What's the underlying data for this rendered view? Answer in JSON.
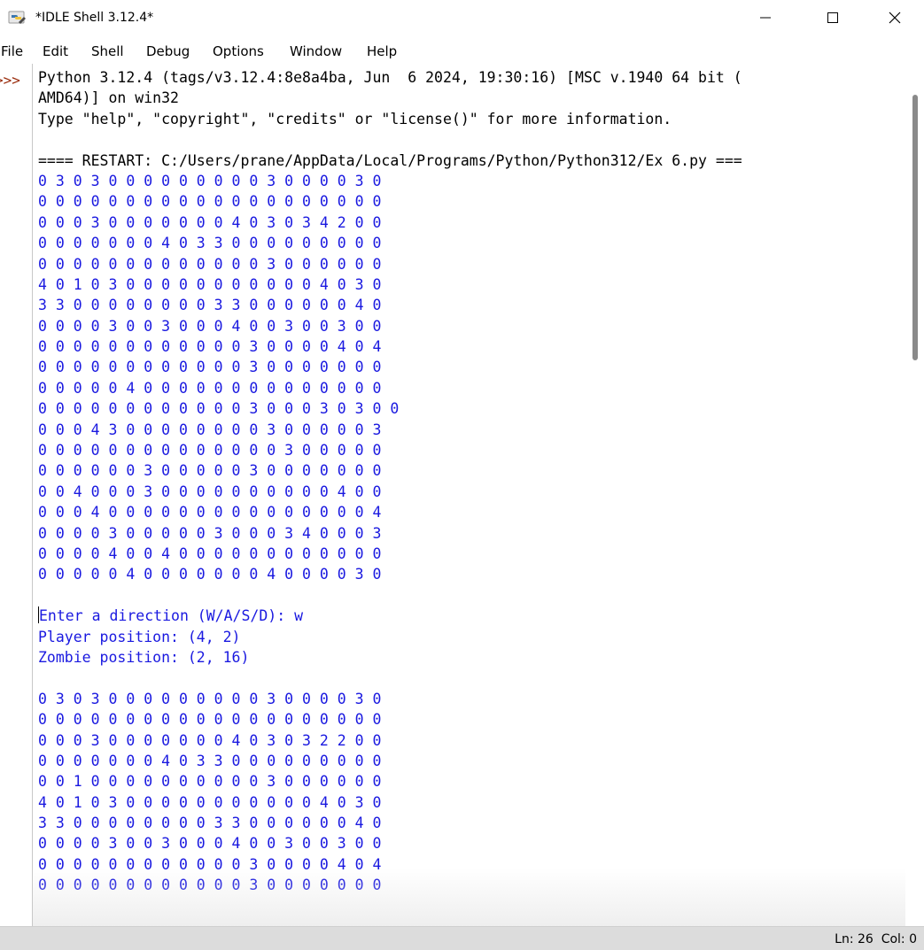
{
  "window": {
    "title": "*IDLE Shell 3.12.4*",
    "buttons": {
      "minimize": "—",
      "maximize": "☐",
      "close": "✕"
    }
  },
  "menu": [
    "File",
    "Edit",
    "Shell",
    "Debug",
    "Options",
    "Window",
    "Help"
  ],
  "shell": {
    "prompt": ">>>",
    "lines": [
      {
        "kind": "out",
        "text": "Python 3.12.4 (tags/v3.12.4:8e8a4ba, Jun  6 2024, 19:30:16) [MSC v.1940 64 bit ("
      },
      {
        "kind": "out",
        "text": "AMD64)] on win32"
      },
      {
        "kind": "out",
        "text": "Type \"help\", \"copyright\", \"credits\" or \"license()\" for more information."
      },
      {
        "kind": "out",
        "text": ""
      },
      {
        "kind": "out",
        "text": "==== RESTART: C:/Users/prane/AppData/Local/Programs/Python/Python312/Ex 6.py ==="
      },
      {
        "kind": "stdout",
        "text": "0 3 0 3 0 0 0 0 0 0 0 0 0 3 0 0 0 0 3 0"
      },
      {
        "kind": "stdout",
        "text": "0 0 0 0 0 0 0 0 0 0 0 0 0 0 0 0 0 0 0 0"
      },
      {
        "kind": "stdout",
        "text": "0 0 0 3 0 0 0 0 0 0 0 4 0 3 0 3 4 2 0 0"
      },
      {
        "kind": "stdout",
        "text": "0 0 0 0 0 0 0 4 0 3 3 0 0 0 0 0 0 0 0 0"
      },
      {
        "kind": "stdout",
        "text": "0 0 0 0 0 0 0 0 0 0 0 0 0 3 0 0 0 0 0 0"
      },
      {
        "kind": "stdout",
        "text": "4 0 1 0 3 0 0 0 0 0 0 0 0 0 0 0 4 0 3 0"
      },
      {
        "kind": "stdout",
        "text": "3 3 0 0 0 0 0 0 0 0 3 3 0 0 0 0 0 0 4 0"
      },
      {
        "kind": "stdout",
        "text": "0 0 0 0 3 0 0 3 0 0 0 4 0 0 3 0 0 3 0 0"
      },
      {
        "kind": "stdout",
        "text": "0 0 0 0 0 0 0 0 0 0 0 0 3 0 0 0 0 4 0 4"
      },
      {
        "kind": "stdout",
        "text": "0 0 0 0 0 0 0 0 0 0 0 0 3 0 0 0 0 0 0 0"
      },
      {
        "kind": "stdout",
        "text": "0 0 0 0 0 4 0 0 0 0 0 0 0 0 0 0 0 0 0 0"
      },
      {
        "kind": "stdout",
        "text": "0 0 0 0 0 0 0 0 0 0 0 0 3 0 0 0 3 0 3 0 0"
      },
      {
        "kind": "stdout",
        "text": "0 0 0 4 3 0 0 0 0 0 0 0 0 3 0 0 0 0 0 3"
      },
      {
        "kind": "stdout",
        "text": "0 0 0 0 0 0 0 0 0 0 0 0 0 0 3 0 0 0 0 0"
      },
      {
        "kind": "stdout",
        "text": "0 0 0 0 0 0 3 0 0 0 0 0 3 0 0 0 0 0 0 0"
      },
      {
        "kind": "stdout",
        "text": "0 0 4 0 0 0 3 0 0 0 0 0 0 0 0 0 0 4 0 0"
      },
      {
        "kind": "stdout",
        "text": "0 0 0 4 0 0 0 0 0 0 0 0 0 0 0 0 0 0 0 4"
      },
      {
        "kind": "stdout",
        "text": "0 0 0 0 3 0 0 0 0 0 3 0 0 0 3 4 0 0 0 3"
      },
      {
        "kind": "stdout",
        "text": "0 0 0 0 4 0 0 4 0 0 0 0 0 0 0 0 0 0 0 0"
      },
      {
        "kind": "stdout",
        "text": "0 0 0 0 0 4 0 0 0 0 0 0 0 4 0 0 0 0 3 0"
      },
      {
        "kind": "stdout",
        "text": ""
      },
      {
        "kind": "stdin",
        "text": "Enter a direction (W/A/S/D): w",
        "caret": true
      },
      {
        "kind": "stdout",
        "text": "Player position: (4, 2)"
      },
      {
        "kind": "stdout",
        "text": "Zombie position: (2, 16)"
      },
      {
        "kind": "stdout",
        "text": ""
      },
      {
        "kind": "stdout",
        "text": "0 3 0 3 0 0 0 0 0 0 0 0 0 3 0 0 0 0 3 0"
      },
      {
        "kind": "stdout",
        "text": "0 0 0 0 0 0 0 0 0 0 0 0 0 0 0 0 0 0 0 0"
      },
      {
        "kind": "stdout",
        "text": "0 0 0 3 0 0 0 0 0 0 0 4 0 3 0 3 2 2 0 0"
      },
      {
        "kind": "stdout",
        "text": "0 0 0 0 0 0 0 4 0 3 3 0 0 0 0 0 0 0 0 0"
      },
      {
        "kind": "stdout",
        "text": "0 0 1 0 0 0 0 0 0 0 0 0 0 3 0 0 0 0 0 0"
      },
      {
        "kind": "stdout",
        "text": "4 0 1 0 3 0 0 0 0 0 0 0 0 0 0 0 4 0 3 0"
      },
      {
        "kind": "stdout",
        "text": "3 3 0 0 0 0 0 0 0 0 3 3 0 0 0 0 0 0 4 0"
      },
      {
        "kind": "stdout",
        "text": "0 0 0 0 3 0 0 3 0 0 0 4 0 0 3 0 0 3 0 0"
      },
      {
        "kind": "stdout",
        "text": "0 0 0 0 0 0 0 0 0 0 0 0 3 0 0 0 0 4 0 4"
      },
      {
        "kind": "stdout",
        "text": "0 0 0 0 0 0 0 0 0 0 0 0 3 0 0 0 0 0 0 0"
      }
    ]
  },
  "status": {
    "text": "Ln: 26  Col: 0"
  },
  "colors": {
    "output": "#000000",
    "stdout": "#1a19e0",
    "prompt": "#9a2c0c",
    "statusbar": "#dcdcdc"
  }
}
